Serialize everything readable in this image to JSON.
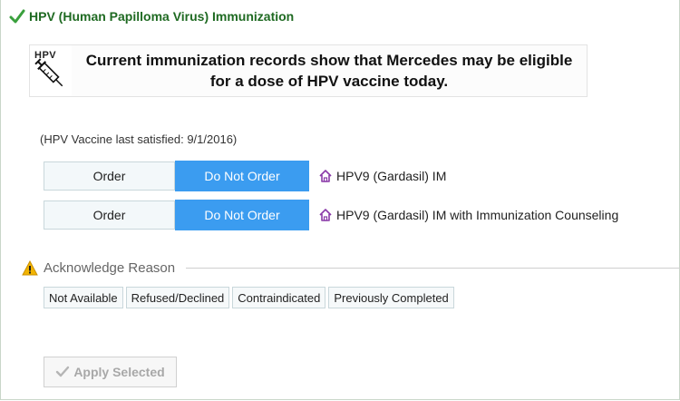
{
  "header": {
    "title": "HPV (Human Papilloma Virus) Immunization",
    "check_color": "#3aa03d"
  },
  "banner": {
    "logo_text": "HPV",
    "message": "Current immunization records show that Mercedes may be eligible for a dose of HPV vaccine today."
  },
  "last_satisfied": "(HPV Vaccine last satisfied: 9/1/2016)",
  "orders": [
    {
      "order_label": "Order",
      "do_not_order_label": "Do Not Order",
      "item": "HPV9 (Gardasil) IM",
      "icon": "home-icon"
    },
    {
      "order_label": "Order",
      "do_not_order_label": "Do Not Order",
      "item": "HPV9 (Gardasil) IM with Immunization Counseling",
      "icon": "home-icon"
    }
  ],
  "acknowledge": {
    "label": "Acknowledge Reason",
    "reasons": [
      "Not Available",
      "Refused/Declined",
      "Contraindicated",
      "Previously Completed"
    ]
  },
  "apply_button": "Apply Selected",
  "colors": {
    "title_green": "#1f6a22",
    "selected_blue": "#3b9cf0",
    "home_icon_purple": "#8a3aa8",
    "warning_yellow": "#f2b400"
  }
}
